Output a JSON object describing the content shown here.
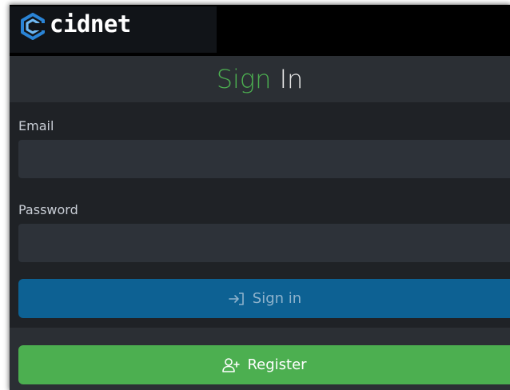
{
  "brand": {
    "name": "cidnet"
  },
  "header": {
    "title_part1": "Sign",
    "title_part2": "In"
  },
  "form": {
    "email": {
      "label": "Email",
      "value": "",
      "placeholder": ""
    },
    "password": {
      "label": "Password",
      "value": "",
      "placeholder": ""
    },
    "signin_label": "Sign in"
  },
  "register": {
    "label": "Register"
  },
  "icons": {
    "logo": "cidnet-logo-icon",
    "signin": "sign-in-arrow-icon",
    "register": "person-add-icon"
  },
  "colors": {
    "accent_green": "#4caf50",
    "primary_blue": "#0d6193",
    "logo_blue": "#2a84d6"
  }
}
